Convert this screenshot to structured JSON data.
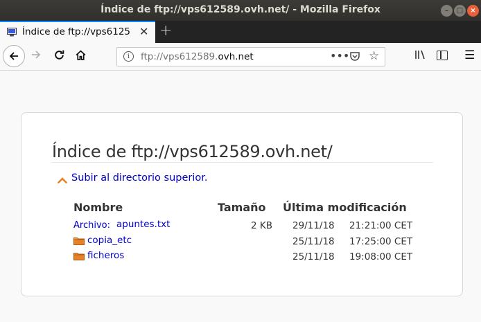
{
  "window": {
    "title": "Índice de ftp://vps612589.ovh.net/ - Mozilla Firefox"
  },
  "tab": {
    "title": "Índice de ftp://vps6125",
    "close_glyph": "✕",
    "new_tab_glyph": "+"
  },
  "navbar": {
    "url_prefix": "ftp://vps612589.",
    "url_domain": "ovh.net",
    "page_actions_glyph": "•••",
    "bookmark_glyph": "☆",
    "menu_glyph": "☰"
  },
  "listing": {
    "heading": "Índice de ftp://vps612589.ovh.net/",
    "parent_link": "Subir al directorio superior.",
    "columns": {
      "name": "Nombre",
      "size": "Tamaño",
      "modified": "Última modificación"
    },
    "rows": [
      {
        "prefix": "Archivo:",
        "name": "apuntes.txt",
        "type": "file",
        "size": "2 KB",
        "date": "29/11/18",
        "time": "21:21:00 CET"
      },
      {
        "prefix": "",
        "name": "copia_etc",
        "type": "folder",
        "size": "",
        "date": "25/11/18",
        "time": "17:25:00 CET"
      },
      {
        "prefix": "",
        "name": "ficheros",
        "type": "folder",
        "size": "",
        "date": "25/11/18",
        "time": "19:08:00 CET"
      }
    ]
  },
  "colors": {
    "titlebar": "#3c3b37",
    "tab_accent": "#0a84ff",
    "link": "#0000cc",
    "folder": "#e8822a",
    "close_button": "#e8603c"
  }
}
